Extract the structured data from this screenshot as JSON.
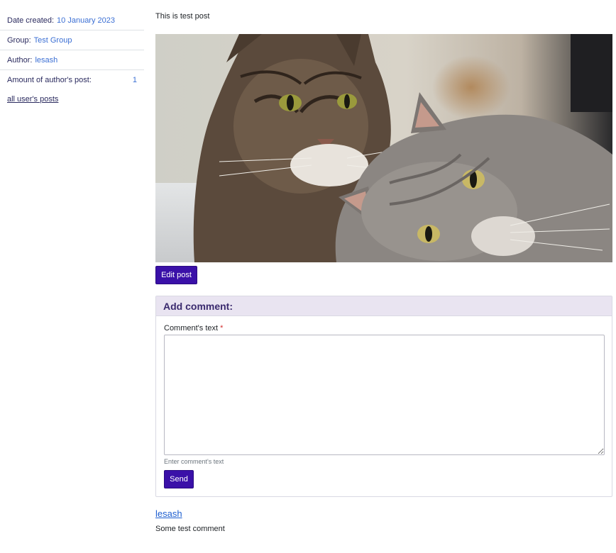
{
  "sidebar": {
    "date_created_label": "Date created:",
    "date_created_value": "10 January 2023",
    "group_label": "Group:",
    "group_value": "Test Group",
    "author_label": "Author:",
    "author_value": "lesash",
    "amount_label": "Amount of author's post:",
    "amount_value": "1",
    "all_posts_link": "all user's posts"
  },
  "post": {
    "text": "This is test post",
    "image_subject": "two tabby cats lying together",
    "edit_button": "Edit post"
  },
  "comment_form": {
    "title": "Add comment:",
    "field_label": "Comment's text",
    "required_mark": "*",
    "textarea_value": "",
    "help_text": "Enter comment's text",
    "send_button": "Send"
  },
  "comments": [
    {
      "author": "lesash",
      "text": "Some test comment"
    }
  ],
  "colors": {
    "button_bg": "#3a10a8",
    "link": "#3b6fd4",
    "card_header_bg": "#e9e4f1"
  }
}
